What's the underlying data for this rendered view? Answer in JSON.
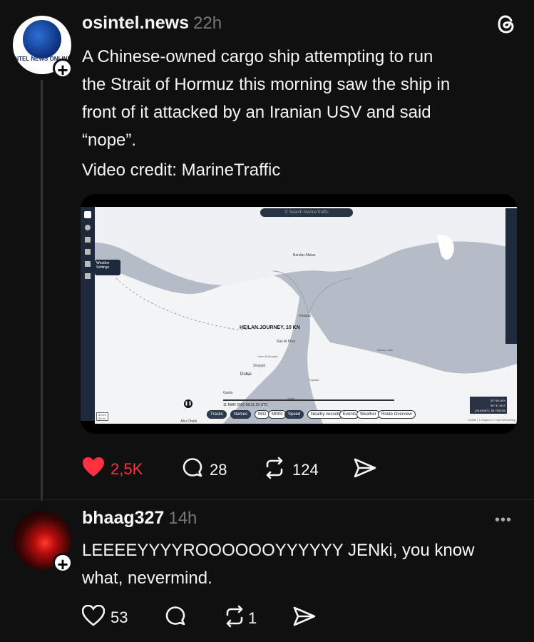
{
  "post": {
    "username": "osintel.news",
    "time": "22h",
    "avatar_text": "INTEL NEWS ONLINE",
    "text_lines": [
      "A Chinese-owned cargo ship attempting to run",
      "the Strait of Hormuz this morning saw the ship in",
      "front of it attacked by an Iranian USV and said",
      "“nope”."
    ],
    "credit": "Video credit: MarineTraffic",
    "likes": "2,5K",
    "comments": "28",
    "reposts": "124",
    "like_color": "#ff3040"
  },
  "map": {
    "search_placeholder": "Search MarineTraffic",
    "weather_label": "Weather Settings",
    "vessel_label": "HEILAN JOURNEY, 10 KN",
    "place_labels": [
      "Bandar Abbas",
      "Khasab",
      "Ras Al Khai",
      "Sharjah",
      "Dubai",
      "Umm Al Quwain",
      "Ganto",
      "Abu Dhabi",
      "Fujairah",
      "Bandar Jask",
      "Sohar"
    ],
    "timestamp": "11 MAR 2026 08:31:29 UTC",
    "chips": [
      "Tracks",
      "Names",
      "IMO",
      "MMSI",
      "Speed",
      "Nearby vessels",
      "Events",
      "Weather",
      "Route Overview"
    ],
    "scale": [
      "50 km",
      "30 mi"
    ],
    "coords": [
      "25° 08.18 N",
      "56° 47.60 E",
      "(25.819672, 56.793339)"
    ],
    "attribution": "Leaflet | © Mapbox © OpenStreetMap"
  },
  "reply": {
    "username": "bhaag327",
    "time": "14h",
    "text_lines": [
      "LEEEEYYYYROOOOOOYYYYYY JENki, you know",
      "what, nevermind."
    ],
    "likes": "53",
    "comments": "",
    "reposts": "1"
  },
  "icons": [
    "threads-logo-icon",
    "heart-icon",
    "comment-icon",
    "repost-icon",
    "share-icon",
    "more-icon"
  ]
}
